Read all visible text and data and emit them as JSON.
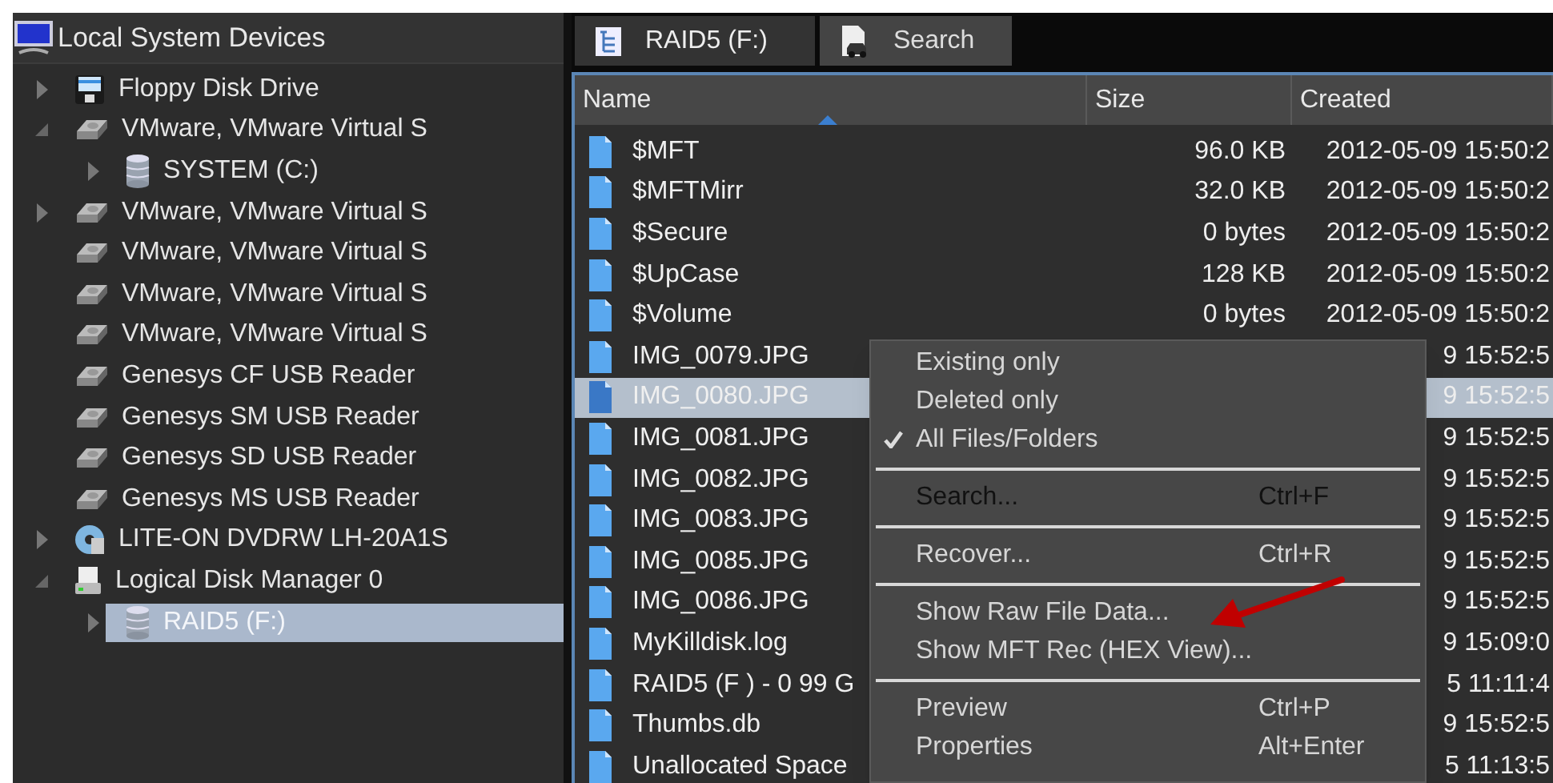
{
  "tree": {
    "title": "Local System Devices",
    "items": [
      {
        "label": "Floppy Disk Drive",
        "kind": "floppy",
        "expanded": false,
        "selected": false
      },
      {
        "label": "VMware, VMware Virtual S",
        "kind": "disk",
        "expanded": true,
        "selected": false,
        "children": [
          {
            "label": "SYSTEM (C:)",
            "kind": "volume",
            "expanded": false,
            "selected": false
          }
        ]
      },
      {
        "label": "VMware, VMware Virtual S",
        "kind": "disk",
        "expanded": false,
        "selected": false
      },
      {
        "label": "VMware, VMware Virtual S",
        "kind": "disk",
        "selected": false
      },
      {
        "label": "VMware, VMware Virtual S",
        "kind": "disk",
        "selected": false
      },
      {
        "label": "VMware, VMware Virtual S",
        "kind": "disk",
        "selected": false
      },
      {
        "label": "Genesys CF  USB Reader",
        "kind": "disk",
        "selected": false
      },
      {
        "label": "Genesys SM  USB Reader",
        "kind": "disk",
        "selected": false
      },
      {
        "label": "Genesys SD  USB Reader",
        "kind": "disk",
        "selected": false
      },
      {
        "label": "Genesys MS  USB Reader",
        "kind": "disk",
        "selected": false
      },
      {
        "label": "LITE-ON DVDRW LH-20A1S",
        "kind": "optical",
        "expanded": false,
        "selected": false
      },
      {
        "label": "Logical Disk Manager 0",
        "kind": "ldm",
        "expanded": true,
        "selected": false,
        "children": [
          {
            "label": "RAID5 (F:)",
            "kind": "volume",
            "expanded": false,
            "selected": true
          }
        ]
      }
    ]
  },
  "tabs": [
    {
      "label": "RAID5 (F:)",
      "kind": "tree",
      "selected": true
    },
    {
      "label": "Search",
      "kind": "search",
      "selected": false
    }
  ],
  "table": {
    "columns": [
      "Name",
      "Size",
      "Created"
    ],
    "rows": [
      {
        "name": "$MFT",
        "size": "96.0 KB",
        "created": "2012-05-09 15:50:2",
        "selected": false
      },
      {
        "name": "$MFTMirr",
        "size": "32.0 KB",
        "created": "2012-05-09 15:50:2",
        "selected": false
      },
      {
        "name": "$Secure",
        "size": "0 bytes",
        "created": "2012-05-09 15:50:2",
        "selected": false
      },
      {
        "name": "$UpCase",
        "size": "128 KB",
        "created": "2012-05-09 15:50:2",
        "selected": false
      },
      {
        "name": "$Volume",
        "size": "0 bytes",
        "created": "2012-05-09 15:50:2",
        "selected": false
      },
      {
        "name": "IMG_0079.JPG",
        "created": "9 15:52:5",
        "selected": false
      },
      {
        "name": "IMG_0080.JPG",
        "created": "9 15:52:5",
        "selected": true
      },
      {
        "name": "IMG_0081.JPG",
        "created": "9 15:52:5",
        "selected": false
      },
      {
        "name": "IMG_0082.JPG",
        "created": "9 15:52:5",
        "selected": false
      },
      {
        "name": "IMG_0083.JPG",
        "created": "9 15:52:5",
        "selected": false
      },
      {
        "name": "IMG_0085.JPG",
        "created": "9 15:52:5",
        "selected": false
      },
      {
        "name": "IMG_0086.JPG",
        "created": "9 15:52:5",
        "selected": false
      },
      {
        "name": "MyKilldisk.log",
        "created": "9 15:09:0",
        "selected": false
      },
      {
        "name": "RAID5 (F ) - 0 99 G",
        "created": "5 11:11:4",
        "selected": false
      },
      {
        "name": "Thumbs.db",
        "created": "9 15:52:5",
        "selected": false
      },
      {
        "name": "Unallocated Space",
        "created": "5 11:13:5",
        "selected": false
      }
    ]
  },
  "context_menu": [
    {
      "kind": "check",
      "label": "Existing only",
      "checked": false
    },
    {
      "kind": "check",
      "label": "Deleted only",
      "checked": false
    },
    {
      "kind": "check",
      "label": "All Files/Folders",
      "checked": true
    },
    {
      "kind": "separator"
    },
    {
      "kind": "item",
      "label": "Search...",
      "shortcut": "Ctrl+F",
      "highlighted": true
    },
    {
      "kind": "separator"
    },
    {
      "kind": "item",
      "label": "Recover...",
      "shortcut": "Ctrl+R",
      "highlighted": false
    },
    {
      "kind": "separator"
    },
    {
      "kind": "item",
      "label": "Show Raw File Data...",
      "highlighted": false
    },
    {
      "kind": "item",
      "label": "Show MFT Rec (HEX View)...",
      "highlighted": false
    },
    {
      "kind": "separator"
    },
    {
      "kind": "item",
      "label": "Preview",
      "shortcut": "Ctrl+P",
      "highlighted": false
    },
    {
      "kind": "item",
      "label": "Properties",
      "shortcut": "Alt+Enter",
      "highlighted": false
    }
  ]
}
